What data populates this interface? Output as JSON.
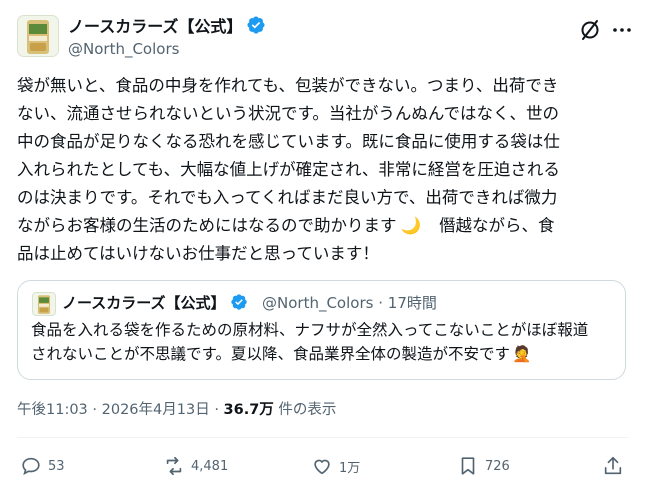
{
  "author": {
    "name": "ノースカラーズ【公式】",
    "handle": "@North_Colors",
    "avatar_icon": "product-package-avatar"
  },
  "header_icons": [
    "grok-icon",
    "more-options-icon"
  ],
  "tweet": {
    "lines": [
      "袋が無いと、食品の中身を作れても、包装ができない。つまり、出荷でき",
      "ない、流通させられないという状況です。当社がうんぬんではなく、世の",
      "中の食品が足りなくなる恐れを感じています。既に食品に使用する袋は仕",
      "入れられたとしても、大幅な値上げが確定され、非常に経営を圧迫される",
      "のは決まりです。それでも入ってくればまだ良い方で、出荷できれば微力",
      "ながらお客様の生活のためにはなるので助かります",
      "品は止めてはいけないお仕事だと思っています！"
    ],
    "line6_tail": "僭越ながら、食",
    "emoji_moon": "🌙"
  },
  "quote": {
    "name": "ノースカラーズ【公式】",
    "handle": "@North_Colors",
    "time": "17時間",
    "separator": "·",
    "lines": [
      "食品を入れる袋を作るための原材料、ナフサが全然入ってこないことがほぼ報道",
      "されないことが不思議です。夏以降、食品業界全体の製造が不安です"
    ],
    "emoji": "🤦"
  },
  "meta": {
    "time": "午後11:03",
    "sep": "·",
    "date": "2026年4月13日",
    "views": "36.7万",
    "views_label": "件の表示"
  },
  "actions": {
    "replies": "53",
    "reposts": "4,481",
    "likes": "1万",
    "bookmarks": "726"
  },
  "colors": {
    "text": "#0f1419",
    "secondary": "#536471",
    "verified": "#1d9bf0",
    "border": "#cfd9de"
  }
}
